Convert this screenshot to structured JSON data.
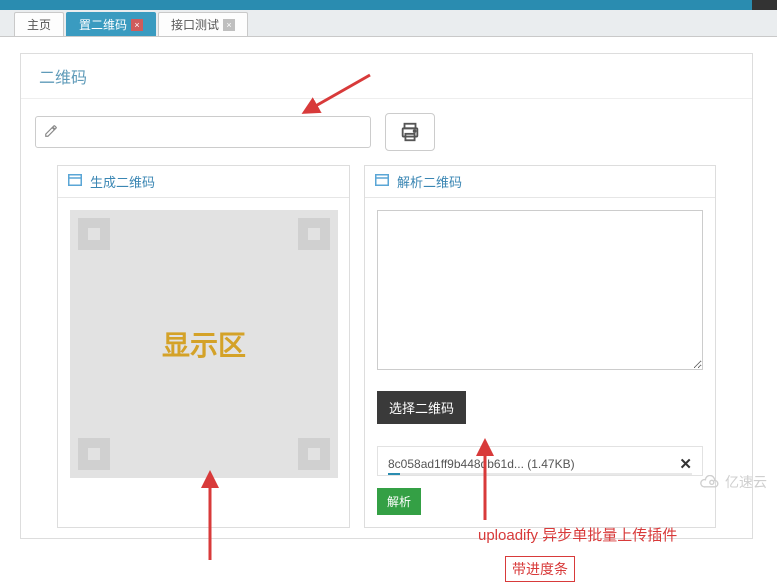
{
  "tabs": {
    "home": "主页",
    "qr": "置二维码",
    "api": "接口测试"
  },
  "panel": {
    "title": "二维码",
    "input_placeholder": "",
    "input_value": ""
  },
  "left": {
    "title": "生成二维码",
    "display_label": "显示区"
  },
  "right": {
    "title": "解析二维码",
    "textarea_value": "",
    "select_btn": "选择二维码",
    "file_name": "8c058ad1ff9b448db61d... (1.47KB)",
    "parse_btn": "解析"
  },
  "annotations": {
    "uploadify": "uploadify 异步单批量上传插件",
    "progress": "带进度条"
  },
  "watermark": "亿速云"
}
